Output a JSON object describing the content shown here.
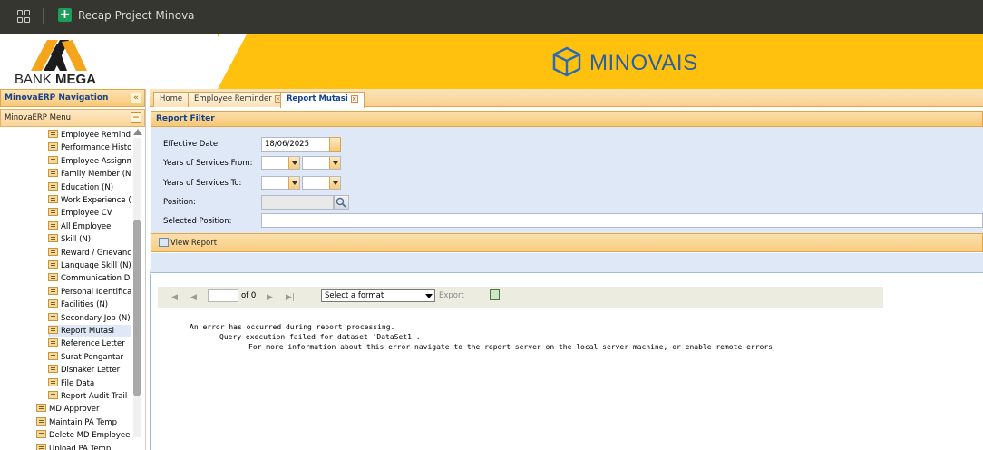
{
  "topbar": {
    "title": "Recap Project Minova",
    "apps_icon": "grid-icon",
    "app_icon": "spreadsheet-icon"
  },
  "banner": {
    "bank_name_light": "BANK ",
    "bank_name_bold": "MEGA",
    "product": "MINOVAIS"
  },
  "nav": {
    "title": "MinovaERP Navigation",
    "menu_title": "MinovaERP Menu",
    "items": [
      {
        "label": "Employee Reminder",
        "level": 2
      },
      {
        "label": "Performance History",
        "level": 2
      },
      {
        "label": "Employee Assignment",
        "level": 2
      },
      {
        "label": "Family Member (N)",
        "level": 2
      },
      {
        "label": "Education (N)",
        "level": 2
      },
      {
        "label": "Work Experience (N)",
        "level": 2
      },
      {
        "label": "Employee CV",
        "level": 2
      },
      {
        "label": "All Employee",
        "level": 2
      },
      {
        "label": "Skill (N)",
        "level": 2
      },
      {
        "label": "Reward / Grievance",
        "level": 2
      },
      {
        "label": "Language Skill (N)",
        "level": 2
      },
      {
        "label": "Communication Data",
        "level": 2
      },
      {
        "label": "Personal Identification",
        "level": 2
      },
      {
        "label": "Facilities (N)",
        "level": 2
      },
      {
        "label": "Secondary Job (N)",
        "level": 2
      },
      {
        "label": "Report Mutasi",
        "level": 2,
        "selected": true
      },
      {
        "label": "Reference Letter",
        "level": 2
      },
      {
        "label": "Surat Pengantar",
        "level": 2
      },
      {
        "label": "Disnaker Letter",
        "level": 2
      },
      {
        "label": "File Data",
        "level": 2
      },
      {
        "label": "Report Audit Trail",
        "level": 2
      },
      {
        "label": "MD Approver",
        "level": 1
      },
      {
        "label": "Maintain PA Temp",
        "level": 1
      },
      {
        "label": "Delete MD Employee",
        "level": 1
      },
      {
        "label": "Upload PA Temp",
        "level": 1
      }
    ]
  },
  "tabs": [
    {
      "label": "Home",
      "closable": false
    },
    {
      "label": "Employee Reminder",
      "closable": true
    },
    {
      "label": "Report Mutasi",
      "closable": true,
      "active": true
    }
  ],
  "filter": {
    "title": "Report Filter",
    "effective_date_label": "Effective Date:",
    "effective_date_value": "18/06/2025",
    "years_from_label": "Years of Services From:",
    "years_to_label": "Years of Services To:",
    "position_label": "Position:",
    "selected_position_label": "Selected Position:",
    "view_report_label": "View Report"
  },
  "viewer": {
    "page_value": "",
    "of_pages": "of 0",
    "format_placeholder": "Select a format",
    "export_label": "Export",
    "error_line1": "An error has occurred during report processing.",
    "error_line2": "Query execution failed for dataset 'DataSet1'.",
    "error_line3": "For more information about this error navigate to the report server on the local server machine, or enable remote errors"
  }
}
